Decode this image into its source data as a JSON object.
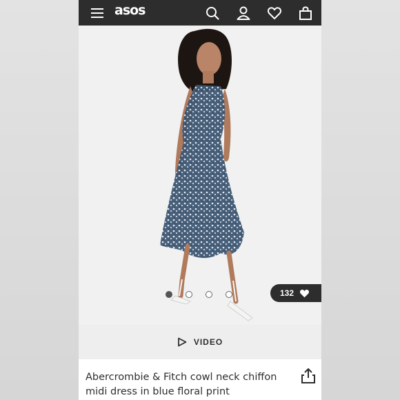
{
  "header": {
    "logo": "asos",
    "icons": [
      "menu-icon",
      "search-icon",
      "account-icon",
      "heart-icon",
      "bag-icon"
    ]
  },
  "product": {
    "likes": "132",
    "gallery": {
      "count": 4,
      "active_index": 0
    },
    "video_label": "VIDEO",
    "title": "Abercrombie & Fitch cowl neck chiffon midi dress in blue floral print"
  },
  "colors": {
    "header_bg": "#2d2d2d",
    "photo_bg": "#f1f1f1",
    "video_bar_bg": "#eeeeee",
    "text": "#2d2d2d"
  }
}
